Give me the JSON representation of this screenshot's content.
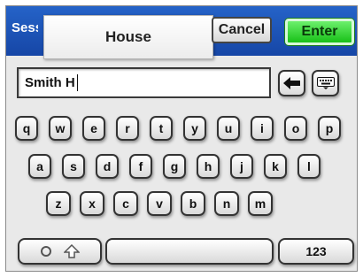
{
  "header": {
    "session_label": "Session",
    "title": "House",
    "cancel_label": "Cancel",
    "enter_label": "Enter"
  },
  "input": {
    "value": "Smith H"
  },
  "icons": {
    "backspace": "left-arrow-icon",
    "keyboard": "keyboard-icon",
    "mode": "circle-icon",
    "shift": "shift-arrow-icon"
  },
  "keyboard": {
    "row1": [
      "q",
      "w",
      "e",
      "r",
      "t",
      "y",
      "u",
      "i",
      "o",
      "p"
    ],
    "row2": [
      "a",
      "s",
      "d",
      "f",
      "g",
      "h",
      "j",
      "k",
      "l"
    ],
    "row3": [
      "z",
      "x",
      "c",
      "v",
      "b",
      "n",
      "m"
    ],
    "numbers_label": "123"
  },
  "colors": {
    "header_blue": "#1e56b8",
    "enter_green": "#22c822"
  }
}
